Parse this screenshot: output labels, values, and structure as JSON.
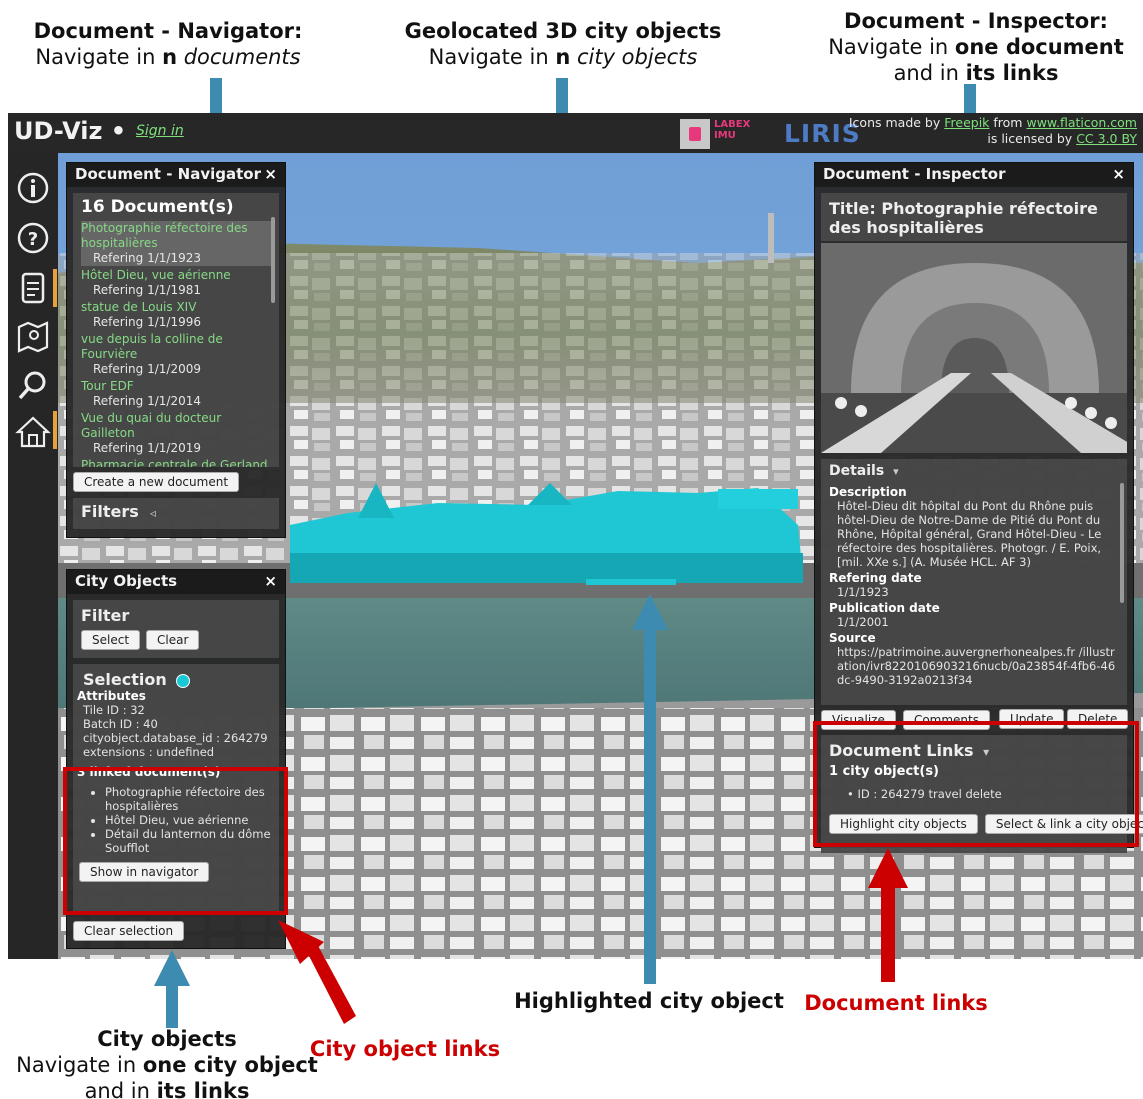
{
  "annotations": {
    "navigator": {
      "title": "Document - Navigator:",
      "line2_pre": "Navigate in ",
      "line2_bold": "n",
      "line2_ital": "documents"
    },
    "city3d": {
      "title": "Geolocated 3D city objects",
      "line2_pre": "Navigate in ",
      "line2_bold": "n",
      "line2_ital": "city objects"
    },
    "inspector": {
      "title": "Document - Inspector:",
      "line2_pre": "Navigate in ",
      "line2_bold": "one document",
      "line3_pre": "and in ",
      "line3_bold": "its links"
    },
    "cityobjects": {
      "title": "City objects",
      "line2_pre": "Navigate in ",
      "line2_bold": "one city object",
      "line3_pre": "and in ",
      "line3_bold": "its links"
    },
    "city_object_links": "City object links",
    "highlighted": "Highlighted city object",
    "document_links": "Document links"
  },
  "app": {
    "brand": "UD-Viz •",
    "sign_in": "Sign in",
    "labex_text": "LABEX IMU",
    "liris_text": "LIRIS",
    "credits_line1_pre": "Icons made by ",
    "credits_author": "Freepik",
    "credits_mid": " from ",
    "credits_site": "www.flaticon.com",
    "credits_line2_pre": "is licensed by ",
    "credits_license": "CC 3.0 BY"
  },
  "sidebar": {
    "icons": [
      "info-icon",
      "help-icon",
      "document-icon",
      "map-icon",
      "search-icon",
      "home-icon"
    ]
  },
  "navigator": {
    "title": "Document - Navigator",
    "close": "×",
    "count": "16 Document(s)",
    "documents": [
      {
        "title": "Photographie réfectoire des hospitalières",
        "ref": "Refering 1/1/1923"
      },
      {
        "title": "Hôtel Dieu, vue aérienne",
        "ref": "Refering 1/1/1981"
      },
      {
        "title": "statue de Louis XIV",
        "ref": "Refering 1/1/1996"
      },
      {
        "title": "vue depuis la colline de Fourvière",
        "ref": "Refering 1/1/2009"
      },
      {
        "title": "Tour EDF",
        "ref": "Refering 1/1/2014"
      },
      {
        "title": "Vue du quai du docteur Gailleton",
        "ref": "Refering 1/1/2019"
      },
      {
        "title": "Pharmacie centrale de Gerland",
        "ref": ""
      }
    ],
    "create_button": "Create a new document",
    "filters": "Filters",
    "filters_chevron": "◃"
  },
  "cityobjects": {
    "title": "City Objects",
    "close": "×",
    "filter_title": "Filter",
    "select_btn": "Select",
    "clear_btn": "Clear",
    "selection_title": "Selection",
    "selection_color": "#17c9d6",
    "attributes_label": "Attributes",
    "attributes": [
      "Tile ID : 32",
      "Batch ID : 40",
      "cityobject.database_id : 264279",
      "extensions : undefined"
    ],
    "linked_label": "3 linked document(s)",
    "linked": [
      "Photographie réfectoire des hospitalières",
      "Hôtel Dieu, vue aérienne",
      "Détail du lanternon du dôme Soufflot"
    ],
    "show_btn": "Show in navigator",
    "clear_selection_btn": "Clear selection"
  },
  "inspector": {
    "title": "Document - Inspector",
    "close": "×",
    "doc_title": "Title: Photographie réfectoire des hospitalières",
    "details": "Details",
    "details_chevron": "▾",
    "description_label": "Description",
    "description": "Hôtel-Dieu dit hôpital du Pont du Rhône puis hôtel-Dieu de Notre-Dame de Pitié du Pont du Rhône, Hôpital général, Grand Hôtel-Dieu - Le réfectoire des hospitalières. Photogr. / E. Poix, [mil. XXe s.] (A. Musée HCL. AF 3)",
    "refering_label": "Refering date",
    "refering": "1/1/1923",
    "publication_label": "Publication date",
    "publication": "1/1/2001",
    "source_label": "Source",
    "source": "https://patrimoine.auvergnerhonealpes.fr /illustration/ivr8220106903216nucb/0a23854f-4fb6-46dc-9490-3192a0213f34",
    "visualize_btn": "Visualize",
    "comments_btn": "Comments",
    "update_btn": "Update",
    "delete_btn": "Delete",
    "links_title": "Document Links",
    "links_chevron": "▾",
    "links_count": "1 city object(s)",
    "link_item": "ID : 264279",
    "link_travel": "travel",
    "link_delete": "delete",
    "highlight_btn": "Highlight city objects",
    "select_link_btn": "Select & link a city object"
  },
  "colors": {
    "highlight": "#17c9d6",
    "annotation_arrow": "#3d8bb0",
    "red": "#cc0000",
    "sky": "#6f9fd6"
  }
}
